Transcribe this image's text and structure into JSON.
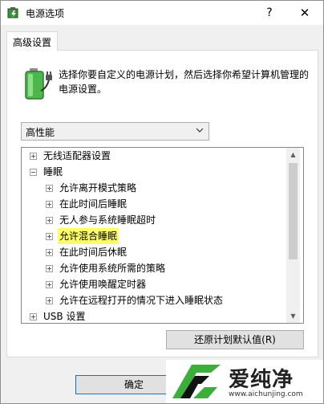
{
  "window": {
    "title": "电源选项",
    "help_label": "?",
    "close_label": "✕"
  },
  "tab": {
    "label": "高级设置"
  },
  "description": "选择你要自定义的电源计划，然后选择你希望计算机管理的电源设置。",
  "plan_select": {
    "value": "高性能"
  },
  "tree": {
    "items": [
      {
        "label": "无线适配器设置",
        "expander": "+"
      },
      {
        "label": "睡眠",
        "expander": "-"
      },
      {
        "label": "允许离开模式策略",
        "expander": "+"
      },
      {
        "label": "在此时间后睡眠",
        "expander": "+"
      },
      {
        "label": "无人参与系统睡眠超时",
        "expander": "+"
      },
      {
        "label": "允许混合睡眠",
        "expander": "+",
        "highlighted": true
      },
      {
        "label": "在此时间后休眠",
        "expander": "+"
      },
      {
        "label": "允许使用系统所需的策略",
        "expander": "+"
      },
      {
        "label": "允许使用唤醒定时器",
        "expander": "+"
      },
      {
        "label": "允许在远程打开的情况下进入睡眠状态",
        "expander": "+"
      },
      {
        "label": "USB 设置",
        "expander": "+"
      }
    ]
  },
  "buttons": {
    "restore": "还原计划默认值(R)",
    "ok": "确定"
  },
  "watermark": {
    "title": "爱纯净",
    "url": "www.aichunjing.com"
  },
  "colors": {
    "highlight": "#ffff66",
    "logo_green": "#3cae3c",
    "focus_border": "#0078d7"
  }
}
